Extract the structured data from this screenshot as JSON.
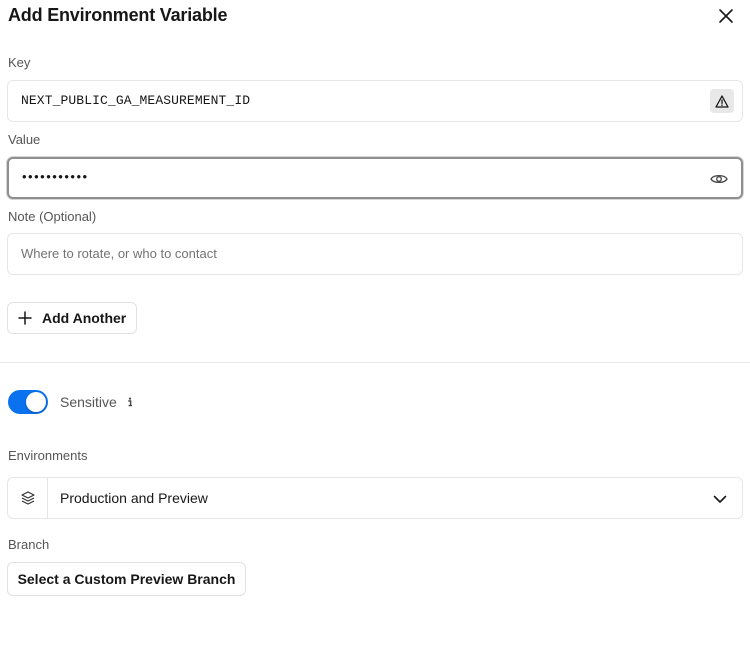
{
  "dialog": {
    "title": "Add Environment Variable",
    "close_icon": "close-icon"
  },
  "key": {
    "label": "Key",
    "value": "NEXT_PUBLIC_GA_MEASUREMENT_ID",
    "warning_icon": "warning-triangle-icon"
  },
  "value": {
    "label": "Value",
    "masked_value": "•••••••••••",
    "reveal_icon": "eye-icon"
  },
  "note": {
    "label": "Note (Optional)",
    "placeholder": "Where to rotate, or who to contact"
  },
  "add_another": {
    "label": "Add Another",
    "icon": "plus-icon"
  },
  "sensitive": {
    "label": "Sensitive",
    "enabled": true,
    "info_icon": "info-icon",
    "toggle_color": "#0a72ef"
  },
  "environments": {
    "label": "Environments",
    "selected": "Production and Preview",
    "icon": "layers-icon",
    "chevron": "chevron-down-icon"
  },
  "branch": {
    "label": "Branch",
    "button_label": "Select a Custom Preview Branch"
  }
}
